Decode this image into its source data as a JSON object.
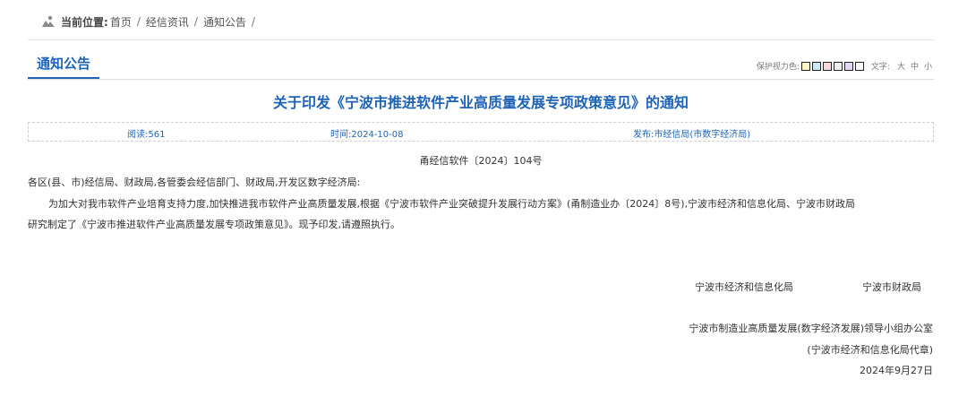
{
  "breadcrumb": {
    "label": "当前位置:",
    "items": [
      "首页",
      "经信资讯",
      "通知公告"
    ],
    "separator": "/"
  },
  "section": {
    "title": "通知公告"
  },
  "tools": {
    "eye_care_label": "保护视力色:",
    "eye_care_colors": [
      "#fdf5c0",
      "#cce6f7",
      "#f7d9e2",
      "#eeeeee",
      "#e3d9f5",
      "#ffffff"
    ],
    "text_label": "文字:",
    "sizes": [
      "大",
      "中",
      "小"
    ]
  },
  "article": {
    "title": "关于印发《宁波市推进软件产业高质量发展专项政策意见》的通知",
    "meta": {
      "reads": "阅读:561",
      "time": "时间:2024-10-08",
      "publisher": "发布:市经信局(市数字经济局)"
    },
    "doc_number": "甬经信软件〔2024〕104号",
    "salutation": "各区(县、市)经信局、财政局,各管委会经信部门、财政局,开发区数字经济局:",
    "paragraph1": "为加大对我市软件产业培育支持力度,加快推进我市软件产业高质量发展,根据《宁波市软件产业突破提升发展行动方案》(甬制造业办〔2024〕8号),宁波市经济和信息化局、宁波市财政局",
    "paragraph2": "研究制定了《宁波市推进软件产业高质量发展专项政策意见》。现予印发,请遵照执行。",
    "signatures": {
      "issuer1": "宁波市经济和信息化局",
      "issuer2": "宁波市财政局",
      "office": "宁波市制造业高质量发展(数字经济发展)领导小组办公室",
      "on_behalf": "(宁波市经济和信息化局代章)",
      "date": "2024年9月27日"
    }
  },
  "colors": {
    "accent": "#1f63b6",
    "text": "#333333"
  }
}
